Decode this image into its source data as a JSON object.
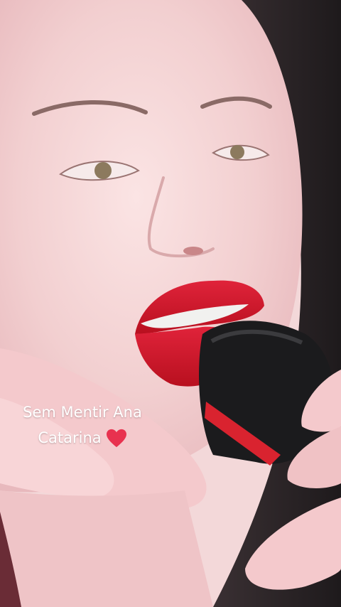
{
  "overlay": {
    "caption_line_1": "Sem Mentir Ana",
    "caption_line_2": "Catarina",
    "caption_emoji": "heart-icon"
  },
  "colors": {
    "caption_text": "#ffffff",
    "heart": "#e8324f"
  }
}
